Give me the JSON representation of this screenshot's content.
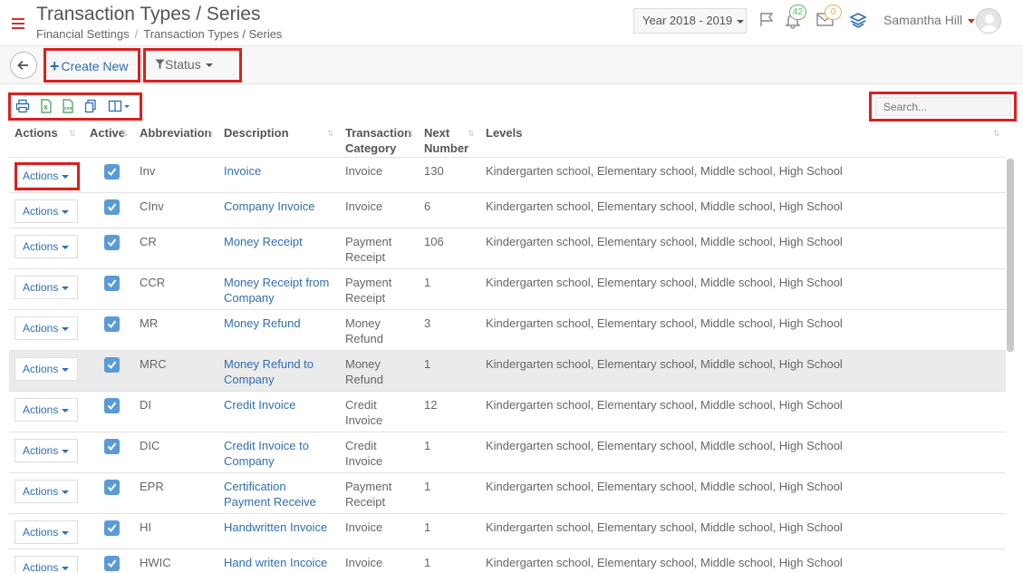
{
  "header": {
    "title": "Transaction Types / Series",
    "breadcrumb": [
      "Financial Settings",
      "Transaction Types / Series"
    ],
    "year_label": "Year 2018 - 2019",
    "notifications_count": "42",
    "messages_count": "0",
    "user_name": "Samantha Hill"
  },
  "toolbar": {
    "create_label": "Create New",
    "status_label": "Status"
  },
  "search": {
    "placeholder": "Search..."
  },
  "table": {
    "columns": {
      "actions": "Actions",
      "active": "Active",
      "abbreviation": "Abbreviation",
      "description": "Description",
      "category_line1": "Transaction",
      "category_line2": "Category",
      "next_line1": "Next",
      "next_line2": "Number",
      "levels": "Levels"
    },
    "action_label": "Actions",
    "rows": [
      {
        "abbr": "Inv",
        "desc1": "Invoice",
        "desc2": "",
        "cat1": "Invoice",
        "cat2": "",
        "next": "130",
        "levels": "Kindergarten school, Elementary school, Middle school, High School"
      },
      {
        "abbr": "CInv",
        "desc1": "Company Invoice",
        "desc2": "",
        "cat1": "Invoice",
        "cat2": "",
        "next": "6",
        "levels": "Kindergarten school, Elementary school, Middle school, High School"
      },
      {
        "abbr": "CR",
        "desc1": "Money Receipt",
        "desc2": "",
        "cat1": "Payment",
        "cat2": "Receipt",
        "next": "106",
        "levels": "Kindergarten school, Elementary school, Middle school, High School"
      },
      {
        "abbr": "CCR",
        "desc1": "Money Receipt from",
        "desc2": "Company",
        "cat1": "Payment",
        "cat2": "Receipt",
        "next": "1",
        "levels": "Kindergarten school, Elementary school, Middle school, High School"
      },
      {
        "abbr": "MR",
        "desc1": "Money Refund",
        "desc2": "",
        "cat1": "Money",
        "cat2": "Refund",
        "next": "3",
        "levels": "Kindergarten school, Elementary school, Middle school, High School"
      },
      {
        "abbr": "MRC",
        "desc1": "Money Refund to",
        "desc2": "Company",
        "cat1": "Money",
        "cat2": "Refund",
        "next": "1",
        "levels": "Kindergarten school, Elementary school, Middle school, High School"
      },
      {
        "abbr": "DI",
        "desc1": "Credit Invoice",
        "desc2": "",
        "cat1": "Credit",
        "cat2": "Invoice",
        "next": "12",
        "levels": "Kindergarten school, Elementary school, Middle school, High School"
      },
      {
        "abbr": "DIC",
        "desc1": "Credit Invoice to",
        "desc2": "Company",
        "cat1": "Credit",
        "cat2": "Invoice",
        "next": "1",
        "levels": "Kindergarten school, Elementary school, Middle school, High School"
      },
      {
        "abbr": "EPR",
        "desc1": "Certification",
        "desc2": "Payment Receive",
        "cat1": "Payment",
        "cat2": "Receipt",
        "next": "1",
        "levels": "Kindergarten school, Elementary school, Middle school, High School"
      },
      {
        "abbr": "HI",
        "desc1": "Handwritten Invoice",
        "desc2": "",
        "cat1": "Invoice",
        "cat2": "",
        "next": "1",
        "levels": "Kindergarten school, Elementary school, Middle school, High School"
      },
      {
        "abbr": "HWIC",
        "desc1": "Hand writen Incoice",
        "desc2": "",
        "cat1": "Invoice",
        "cat2": "",
        "next": "1",
        "levels": "Kindergarten school, Elementary school, Middle school, High School"
      }
    ]
  },
  "colors": {
    "accent": "#2f6fb1",
    "highlight": "#d9201f",
    "checkbox": "#5b9bd5",
    "badge_green": "#5cb85c",
    "badge_orange": "#f0ad4e"
  },
  "icons": [
    "hamburger-icon",
    "flag-icon",
    "bell-icon",
    "envelope-icon",
    "layers-icon",
    "back-arrow-icon",
    "filter-icon",
    "print-icon",
    "excel-icon",
    "csv-icon",
    "copy-icon",
    "columns-icon",
    "sort-icon",
    "check-icon"
  ]
}
